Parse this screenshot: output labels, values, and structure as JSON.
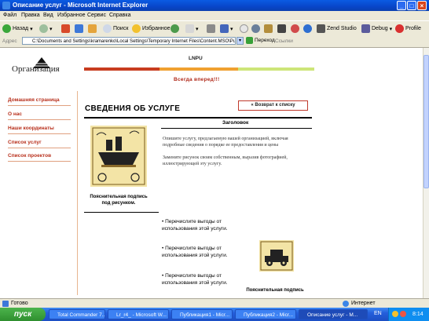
{
  "window": {
    "title": "Описание услуг - Microsoft Internet Explorer"
  },
  "menu": [
    "Файл",
    "Правка",
    "Вид",
    "Избранное",
    "Сервис",
    "Справка"
  ],
  "toolbar": {
    "back": "Назад",
    "search": "Поиск",
    "favorites": "Избранное",
    "zend": "Zend Studio",
    "debug": "Debug",
    "profile": "Profile"
  },
  "address": {
    "label": "Адрес",
    "value": "C:\\Documents and Settings\\kramarenko\\Local Settings\\Temporary Internet Files\\Content.MSO\\PubWebPagePr",
    "go": "Переход",
    "links": "Ссылки"
  },
  "page": {
    "org_name": "Организация",
    "top_label": "LNPU",
    "tagline": "Всегда вперед!!!",
    "sidebar": [
      "Домашняя страница",
      "О нас",
      "Наши координаты",
      "Список услуг",
      "Список проектов"
    ],
    "heading": "Сведения об услуге",
    "back_button": "« Возврат к списку",
    "subheading": "Заголовок",
    "paragraph1": "Опишите услугу, предлагаемую вашей организацией, включая подробные сведения о порядке ее предоставления и цены",
    "paragraph2": "Замените рисунок своим собственным, выразив фотографией, иллюстрирующей эту услугу.",
    "caption1": "Пояснительная подпись под рисунком.",
    "bullets": [
      "Перечислите выгоды от использования этой услуги.",
      "Перечислите выгоды от использования этой услуги.",
      "Перечислите выгоды от использования этой услуги."
    ],
    "caption2": "Пояснительная подпись"
  },
  "status": {
    "left": "Готово",
    "zone": "Интернет"
  },
  "taskbar": {
    "start": "пуск",
    "tasks": [
      "Total Commander 7....",
      "Lr_r4_ - Microsoft W...",
      "Публикация1 - Micr...",
      "Публикация2 - Micr...",
      "Описание услуг - M..."
    ],
    "lang": "EN",
    "clock": "8:14"
  },
  "colors": {
    "accent_red": "#c0392b",
    "accent_orange": "#f0a030",
    "accent_green": "#c8e07a"
  }
}
